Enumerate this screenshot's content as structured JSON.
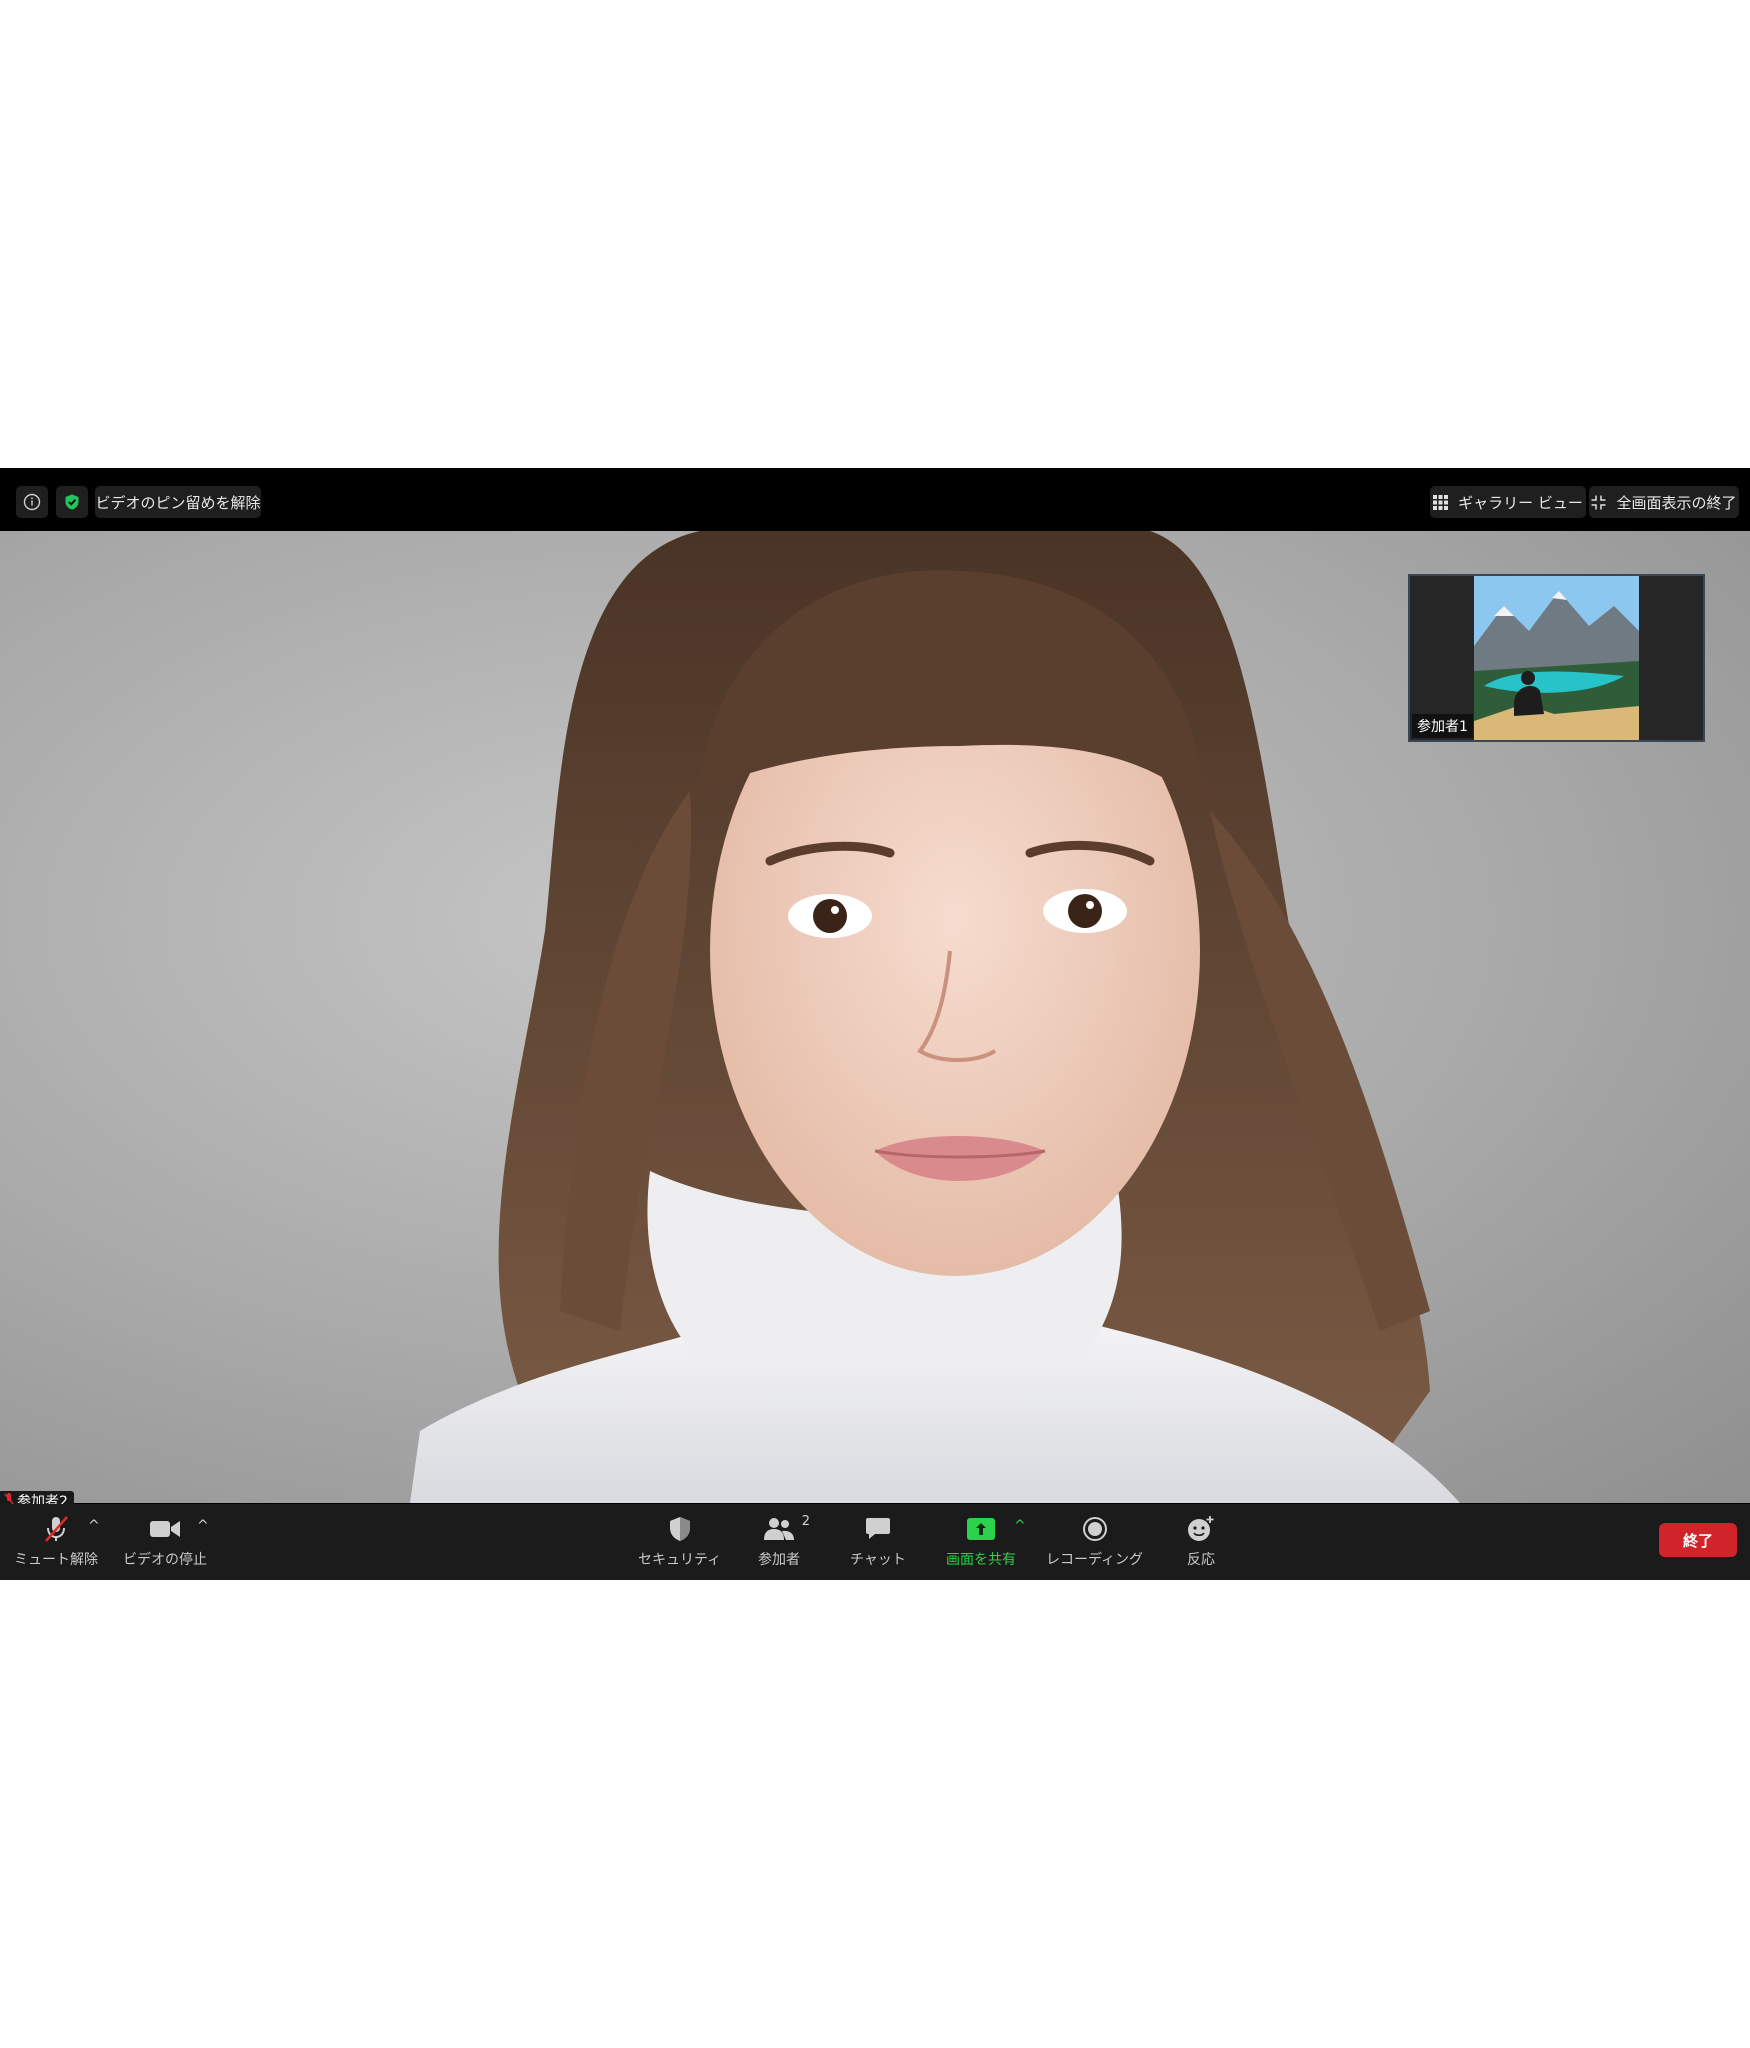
{
  "topbar": {
    "unpin_label": "ビデオのピン留めを解除",
    "gallery_label": "ギャラリー ビュー",
    "exit_fullscreen_label": "全画面表示の終了"
  },
  "thumbnail": {
    "participant_name": "参加者1"
  },
  "main_video": {
    "participant_name": "参加者2"
  },
  "toolbar": {
    "unmute_label": "ミュート解除",
    "stop_video_label": "ビデオの停止",
    "security_label": "セキュリティ",
    "participants_label": "参加者",
    "participants_count": "2",
    "chat_label": "チャット",
    "share_label": "画面を共有",
    "recording_label": "レコーディング",
    "reactions_label": "反応",
    "end_label": "終了"
  },
  "colors": {
    "share_green": "#2bd34d",
    "end_red": "#d0232a",
    "security_green": "#22c55e"
  },
  "icons": [
    "info-icon",
    "shield-check-icon",
    "grid-icon",
    "exit-fullscreen-icon",
    "microphone-muted-icon",
    "video-camera-icon",
    "shield-icon",
    "people-icon",
    "chat-bubble-icon",
    "share-screen-icon",
    "record-icon",
    "emoji-add-icon"
  ]
}
